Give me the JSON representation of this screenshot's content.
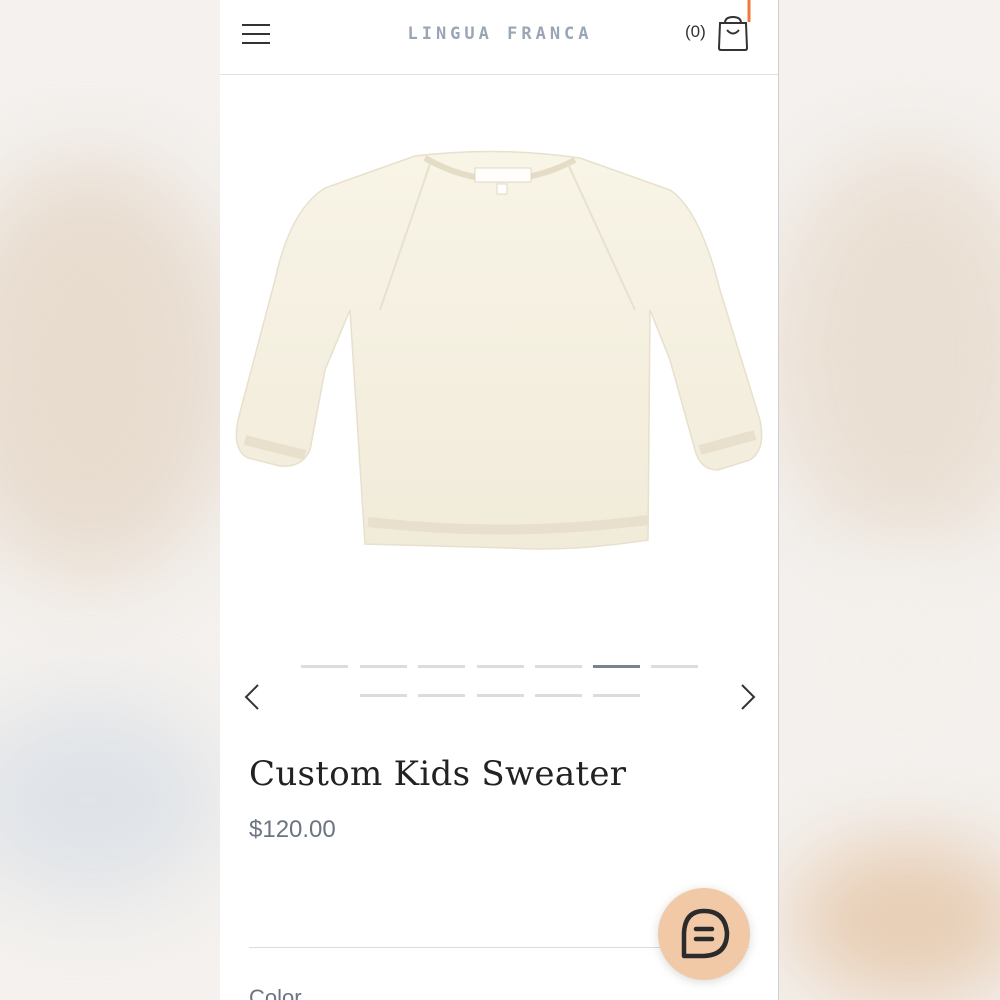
{
  "header": {
    "brand": "LINGUA FRANCA",
    "cart_count": "(0)",
    "menu_icon": "hamburger-menu-icon",
    "cart_icon": "shopping-bag-icon"
  },
  "gallery": {
    "image_alt": "Cream knit kids crewneck sweater",
    "active_slide": 6,
    "slide_count": 12,
    "prev_icon": "chevron-left-icon",
    "next_icon": "chevron-right-icon"
  },
  "product": {
    "title": "Custom Kids Sweater",
    "price": "$120.00",
    "option_label": "Color"
  },
  "chat": {
    "icon": "chat-bubble-icon",
    "color": "#f1c9a6"
  },
  "colors": {
    "accent_active_dot": "#7b838c",
    "price_text": "#6b7480"
  }
}
